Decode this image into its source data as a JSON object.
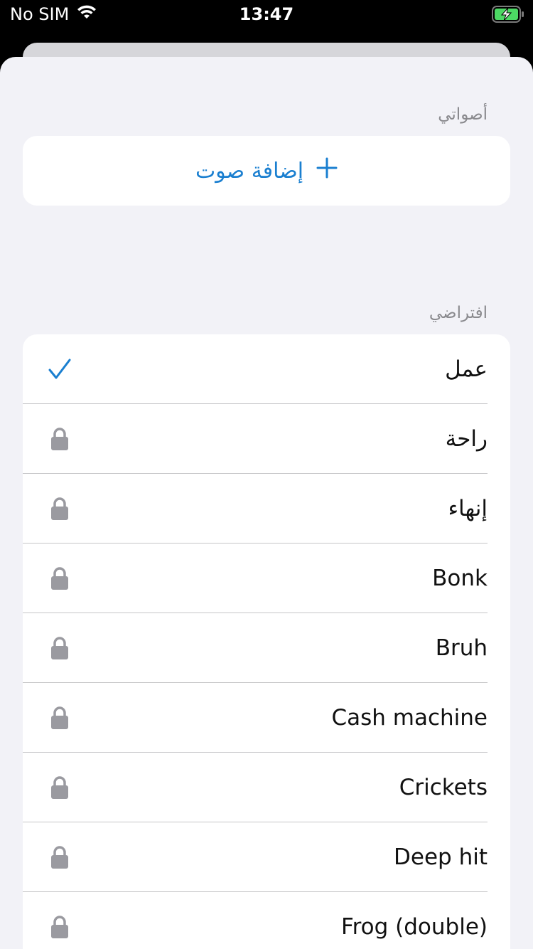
{
  "status_bar": {
    "carrier": "No SIM",
    "time": "13:47",
    "icons": [
      "wifi-icon",
      "battery-charging-icon"
    ]
  },
  "my_sounds": {
    "header": "أصواتي",
    "add_label": "إضافة صوت",
    "add_icon": "plus-icon"
  },
  "default": {
    "header": "افتراضي",
    "items": [
      {
        "label": "عمل",
        "state": "checked"
      },
      {
        "label": "راحة",
        "state": "locked"
      },
      {
        "label": "إنهاء",
        "state": "locked"
      },
      {
        "label": "Bonk",
        "state": "locked"
      },
      {
        "label": "Bruh",
        "state": "locked"
      },
      {
        "label": "Cash machine",
        "state": "locked"
      },
      {
        "label": "Crickets",
        "state": "locked"
      },
      {
        "label": "Deep hit",
        "state": "locked"
      },
      {
        "label": "Frog (double)",
        "state": "locked"
      }
    ]
  },
  "colors": {
    "accent": "#1a7fd0",
    "background": "#f2f2f7",
    "lock": "#9a9aa0"
  }
}
